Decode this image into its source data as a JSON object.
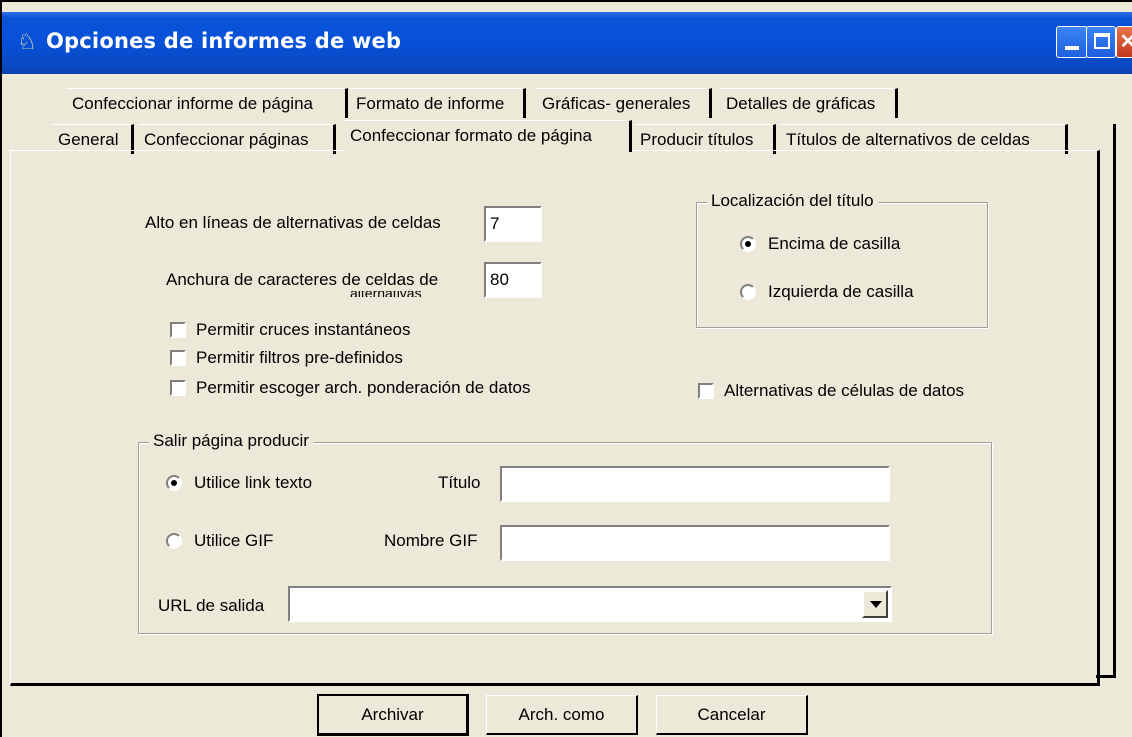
{
  "window": {
    "title": "Opciones de informes de web",
    "icon": "app-figure-icon",
    "minimize_icon": "minimize-icon",
    "maximize_icon": "maximize-icon",
    "close_icon": "close-icon",
    "colors": {
      "titlebar": "#0651d8",
      "close": "#c4371b",
      "face": "#ece9d8"
    }
  },
  "tabs": {
    "row1": [
      {
        "label": "Confeccionar informe de página"
      },
      {
        "label": "Formato de informe"
      },
      {
        "label": "Gráficas- generales"
      },
      {
        "label": "Detalles de gráficas"
      }
    ],
    "row2": [
      {
        "label": "General"
      },
      {
        "label": "Confeccionar páginas"
      },
      {
        "label": "Confeccionar formato de página",
        "active": true
      },
      {
        "label": "Producir títulos"
      },
      {
        "label": "Títulos de alternativos de celdas"
      }
    ]
  },
  "form": {
    "height_label": "Alto en líneas de alternativas de celdas",
    "height_value": "7",
    "width_label": "Anchura de caracteres de celdas de",
    "width_label_cut": "alternativas",
    "width_value": "80",
    "allow_crosstabs": "Permitir cruces instantáneos",
    "allow_filters": "Permitir filtros pre-definidos",
    "allow_weighting": "Permitir escoger arch. ponderación de datos",
    "data_cell_alternatives": "Alternativas de células de datos",
    "title_location": {
      "legend": "Localización del título",
      "above": "Encima de casilla",
      "left": "Izquierda de casilla",
      "selected": "above"
    },
    "exit_page": {
      "legend": "Salir página producir",
      "use_text_link": "Utilice link texto",
      "use_gif": "Utilice GIF",
      "selected": "text",
      "title_label": "Título",
      "title_value": "",
      "gif_name_label": "Nombre GIF",
      "gif_name_value": "",
      "url_label": "URL de salida",
      "url_value": ""
    }
  },
  "buttons": {
    "save": "Archivar",
    "save_as": "Arch. como",
    "cancel": "Cancelar"
  }
}
